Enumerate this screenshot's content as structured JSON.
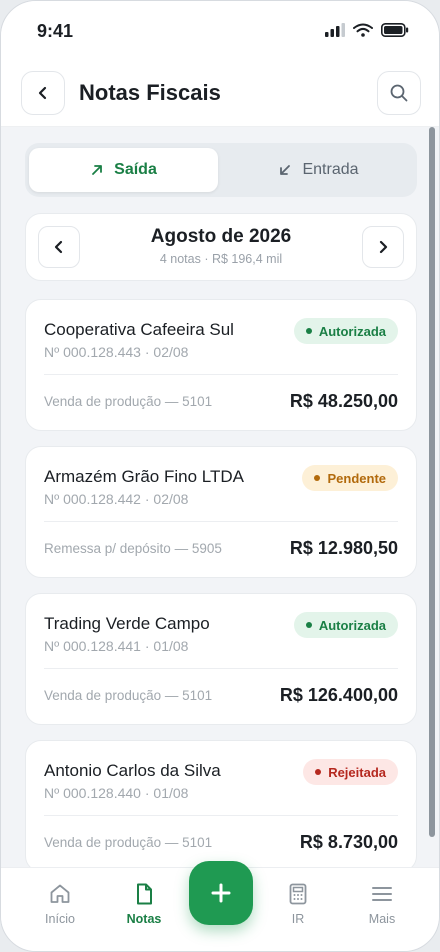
{
  "status_bar": {
    "time": "9:41"
  },
  "header": {
    "title": "Notas Fiscais",
    "back_icon": "chevron-left-icon",
    "search_icon": "search-icon"
  },
  "tabs": {
    "saida": {
      "label": "Saída",
      "icon": "arrow-up-right-icon",
      "selected": true
    },
    "entrada": {
      "label": "Entrada",
      "icon": "arrow-down-left-icon",
      "selected": false
    }
  },
  "month": {
    "title": "Agosto de 2026",
    "summary": "4 notas · R$ 196,4 mil"
  },
  "invoices": [
    {
      "name": "Cooperativa Cafeeira Sul",
      "number": "Nº 000.128.443 · 02/08",
      "description": "Venda de produção — 5101",
      "value": "R$ 48.250,00",
      "status": "Autorizada",
      "status_type": "ok"
    },
    {
      "name": "Armazém Grão Fino LTDA",
      "number": "Nº 000.128.442 · 02/08",
      "description": "Remessa p/ depósito — 5905",
      "value": "R$ 12.980,50",
      "status": "Pendente",
      "status_type": "pend"
    },
    {
      "name": "Trading Verde Campo",
      "number": "Nº 000.128.441 · 01/08",
      "description": "Venda de produção — 5101",
      "value": "R$ 126.400,00",
      "status": "Autorizada",
      "status_type": "ok"
    },
    {
      "name": "Antonio Carlos da Silva",
      "number": "Nº 000.128.440 · 01/08",
      "description": "Venda de produção — 5101",
      "value": "R$ 8.730,00",
      "status": "Rejeitada",
      "status_type": "rej"
    }
  ],
  "nav": {
    "inicio": {
      "label": "Início",
      "icon": "home-icon"
    },
    "notas": {
      "label": "Notas",
      "icon": "document-icon",
      "active": true
    },
    "fab": {
      "icon": "plus-icon"
    },
    "ir": {
      "label": "IR",
      "icon": "calculator-icon"
    },
    "mais": {
      "label": "Mais",
      "icon": "menu-icon"
    }
  },
  "colors": {
    "brand_green": "#1f9a52",
    "text": "#1b1f24",
    "muted": "#a2a8ae"
  }
}
